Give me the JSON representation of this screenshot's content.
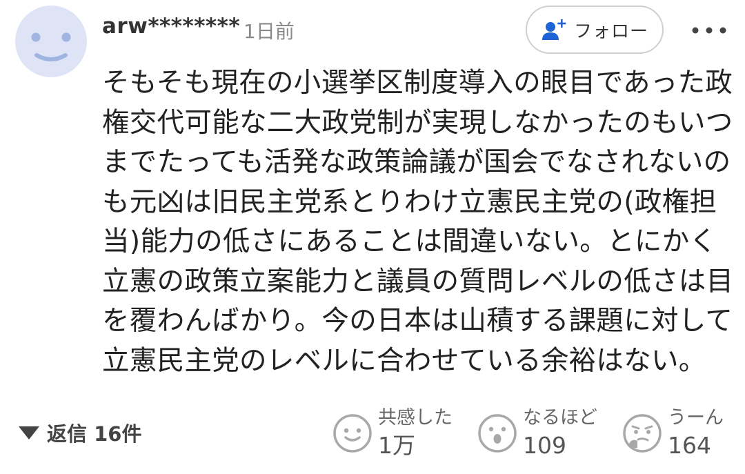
{
  "comment": {
    "author": "arw********",
    "timestamp": "1日前",
    "follow_label": "フォロー",
    "body_lines": [
      "そもそも現在の小選挙区制度導入の眼目であった政",
      "権交代可能な二大政党制が実現しなかったのもいつ",
      "までたっても活発な政策論議が国会でなされないの",
      "も元凶は旧民主党系とりわけ立憲民主党の(政権担",
      "当)能力の低さにあることは間違いない。とにかく",
      "立憲の政策立案能力と議員の質問レベルの低さは目",
      "を覆わんばかり。今の日本は山積する課題に対して",
      "立憲民主党のレベルに合わせている余裕はない。"
    ]
  },
  "replies": {
    "label": "返信 16件"
  },
  "reactions": [
    {
      "label": "共感した",
      "count": "1万",
      "icon": "smile-face-icon"
    },
    {
      "label": "なるほど",
      "count": "109",
      "icon": "surprised-face-icon"
    },
    {
      "label": "うーん",
      "count": "164",
      "icon": "thinking-face-icon"
    }
  ],
  "colors": {
    "avatar_bg": "#dfe3f6",
    "avatar_face": "#9fb4e0",
    "follow_icon": "#1e63d6",
    "reaction_icon": "#a8a8a8"
  }
}
